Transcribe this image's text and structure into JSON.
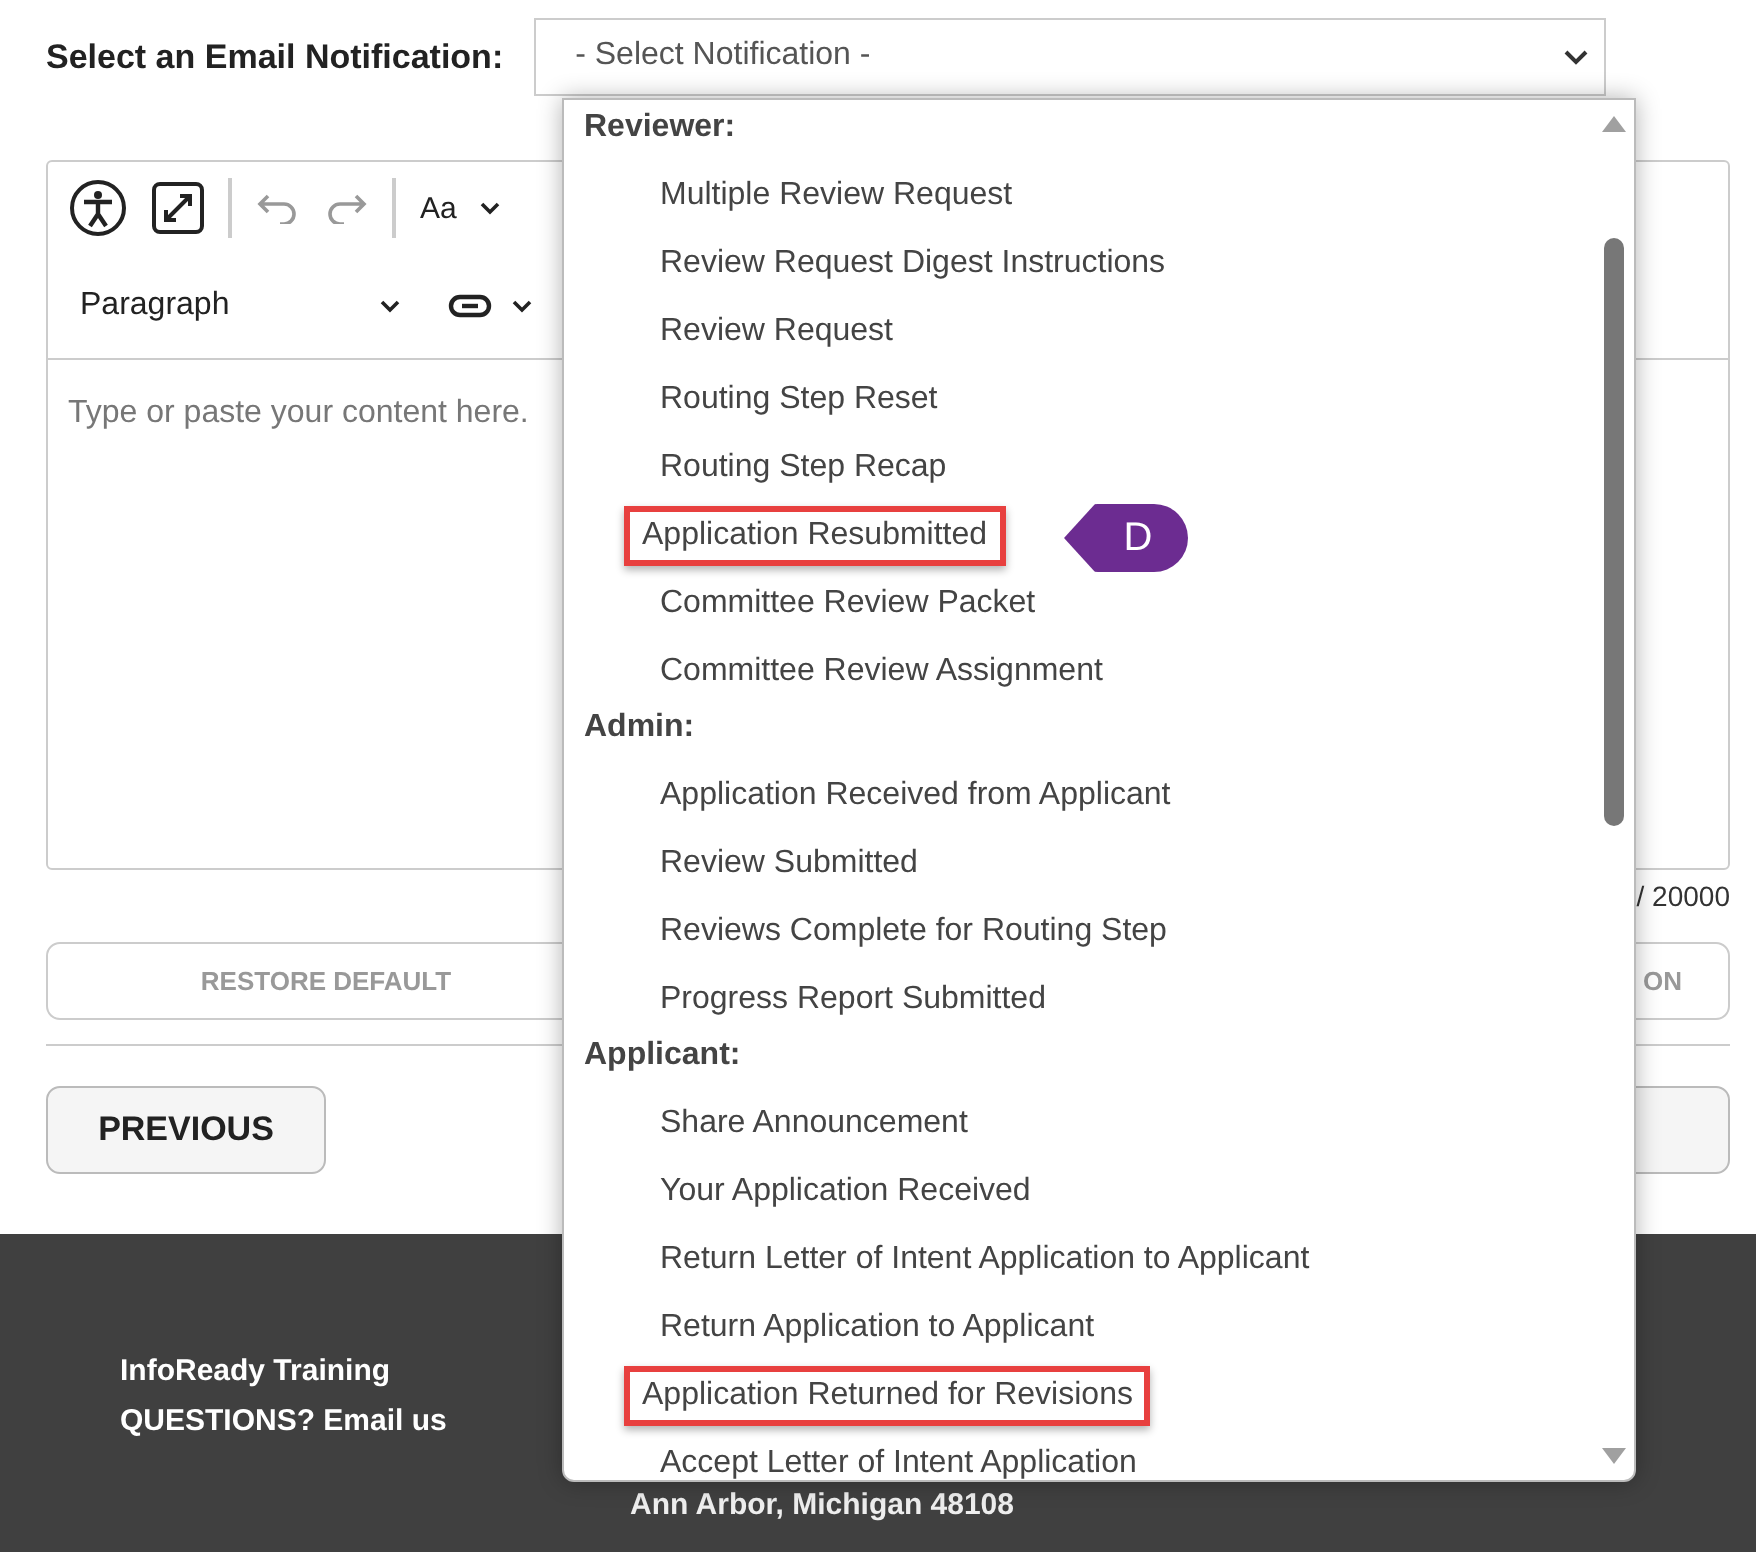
{
  "field": {
    "label": "Select an Email Notification:",
    "placeholder": "- Select Notification -"
  },
  "editor": {
    "block_style": "Paragraph",
    "font_button": "Aa",
    "placeholder": "Type or paste your content here.",
    "counter": "/ 20000"
  },
  "buttons": [
    {
      "label": "RESTORE DEFAULT"
    },
    {
      "label": "ON"
    }
  ],
  "nav": [
    {
      "label": "PREVIOUS"
    }
  ],
  "footer": {
    "lines": [
      "InfoReady Training",
      "QUESTIONS? Email us"
    ],
    "address": "Ann Arbor, Michigan 48108"
  },
  "dropdown": {
    "groups": [
      {
        "title": "Reviewer:",
        "items": [
          {
            "label": "Multiple Review Request",
            "highlighted": false
          },
          {
            "label": "Review Request Digest Instructions",
            "highlighted": false
          },
          {
            "label": "Review Request",
            "highlighted": false
          },
          {
            "label": "Routing Step Reset",
            "highlighted": false
          },
          {
            "label": "Routing Step Recap",
            "highlighted": false
          },
          {
            "label": "Application Resubmitted",
            "highlighted": true,
            "callout": "D"
          },
          {
            "label": "Committee Review Packet",
            "highlighted": false
          },
          {
            "label": "Committee Review Assignment",
            "highlighted": false
          }
        ]
      },
      {
        "title": "Admin:",
        "items": [
          {
            "label": "Application Received from Applicant",
            "highlighted": false
          },
          {
            "label": "Review Submitted",
            "highlighted": false
          },
          {
            "label": "Reviews Complete for Routing Step",
            "highlighted": false
          },
          {
            "label": "Progress Report Submitted",
            "highlighted": false
          }
        ]
      },
      {
        "title": "Applicant:",
        "items": [
          {
            "label": "Share Announcement",
            "highlighted": false
          },
          {
            "label": "Your Application Received",
            "highlighted": false
          },
          {
            "label": "Return Letter of Intent Application to Applicant",
            "highlighted": false
          },
          {
            "label": "Return Application to Applicant",
            "highlighted": false
          },
          {
            "label": "Application Returned for Revisions",
            "highlighted": true
          },
          {
            "label": "Accept Letter of Intent Application",
            "highlighted": false
          }
        ]
      }
    ]
  }
}
